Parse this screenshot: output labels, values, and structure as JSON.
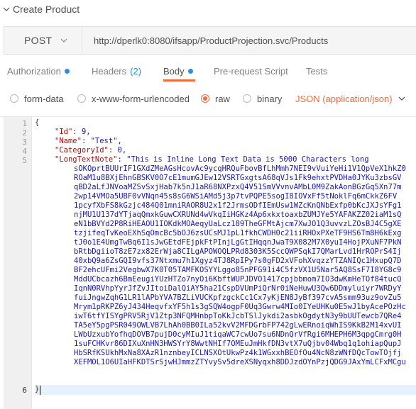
{
  "header": {
    "title": "Create Product"
  },
  "request": {
    "method": "POST",
    "url": "http://dperlk0:8080/ifsapp/ProductProjection.svc/Products"
  },
  "tabs": [
    {
      "label": "Authorization",
      "dot": true
    },
    {
      "label": "Headers",
      "count": "(2)"
    },
    {
      "label": "Body",
      "dot": true
    },
    {
      "label": "Pre-request Script"
    },
    {
      "label": "Tests"
    }
  ],
  "body_options": {
    "form_data": "form-data",
    "urlencoded": "x-www-form-urlencoded",
    "raw": "raw",
    "binary": "binary",
    "format": "JSON (application/json)"
  },
  "editor": {
    "line_numbers": [
      "1",
      "2",
      "3",
      "4",
      "5",
      "6"
    ],
    "open_brace": "{",
    "close_brace": "}",
    "key_id": "\"Id\"",
    "val_id": "9,",
    "key_name": "\"Name\"",
    "val_name": "\"Test\",",
    "key_category": "\"CategoryId\"",
    "val_category": "0,",
    "key_note": "\"LongTextNote\"",
    "note_first": "\"This is Inline Long Text Data is 5000 Characters long",
    "note_lines": [
      "sOKOprtBUUrIF1GXdZMeAGsHcovAc9ycqHRQuFbovBfLhMmh7NEI9vVuiYeHi1V1QpVeX1hkZ0",
      "ROaM1u8BXjEhnGBSKV0O7cE1mumGJEw12VSRTGxgtsA68qVJs1Fk9ehxtPVDHa0JYKu3zbsGV",
      "qBD2aLfJNVoaMZSvSxjHab7k5nJ1aR68NXPzxQ4V51SmVVvnvAMbL0M9ZakAonBGzGq5Xn77m",
      "2wp14VMOa5UBF0vVNqn45s8sG6WSiAMd5j3p7tvPQPE5sogI8IOVxFf5tNoklFq6mCkkZ6FV",
      "1pcyfXbFS8kGzjc484Q01mniRAOR8U2x1f2JrmsODfIEmUsw1WZcKnQNbExfp0bKcJXJsYFg1",
      "njMU1U137dYTjaqQmxkGuwCXRUNd4wVkqIiHGKz4Ap6xkxtoaxbZUMJYe5YAFAKZZ02iaM1sQ",
      "eN1bBVYd2P8RiHEAOU1IOKdkMOAeqyUaLcz189TheGFMtAjcm7XwJO1Q3uvvzLZOsBJ4C5gXE",
      "tzjifeqTvKeoEXhSqOmcBc5bOJ6zsUCsMJ1pL1fkhCWDH0c21iiRHOxPXeTF9HS6Tm8H6kExg",
      "tJ0o1E4UmgTwBq6I1sJwGEtdFEjpkFtPInjLgGtIHqqnJwaT9X082M7X0yuI4HojPXuNF7PkN",
      "bRtbDgiioT8zE7zx82ErWja8CILgAPOWOQLPRd8303K5SccQWPSqkI7QMarLvd1HrROPrS4Ij",
      "40xbQ9a6ZsGQI9vfs37Ntxmu7h1Xgyz4TJ8RpIPy7s0gFD2xVFohXvqzzYTZANIQc1HxupQ7D",
      "BF2ehcUFmi2VegbwX7K0T05TAMFKOSYYLggo85nPFG91i4C5fzVX1U5Nar5AQ8SsF7I8YG8c9",
      "MddUCbcazh6BmEeugiYUzHTZo7nyOi6KbftWUPJDVO1417cpjbbmom7IO3dwKmHeTOf84tucQ",
      "IqnN0RVhpYyrJfZvJItoiDalQiAY5ha21CspDVUmPiQrNr0iNeHuwU3Qw6DDmyluiyr7WRDyY",
      "fuiJngwZqhG1LR1lAPbYVA7BZLiVUCKpfzgckCc1Cx7yKjEN8JyBf397cvA5smm93uz9ovZu5",
      "Mrym1pRKPZ6yJ434HeqvfxYF5h1s3gSQW4ogpF0Uq3Gwrw4MIo0IYeUHKu0E5wJ1byAcePOzHc",
      "iwT6tfYISYgPRV5RjV1Ztp3NFQMHnbpToKkJcbTSlJykdi2asbkOgdytN3y9bUUTewcb7QRe4",
      "TA5eY5pgPSR049OWLVB7LhAh0BB0ILa52kvV2MFDGrbFP742gLwERnoiqWhIS9KkB2M14xvUI",
      "LWbUzxubYofhqDOVB7pujD0cyMIuJ1tiqaWC7cwUo7su6NDnQrVfRgi6MHEPH6M3qpgCmrg0H",
      "1suFCHKvr86DIXuXnHN3HWSYrY8WwtNHIf7OMEuJmHkfDN3vtX7uQjbv04Wbq1q1ohiapQupJ",
      "HbSRfKSUkhMxNa8XAzR1nznbeyICLNSXOtUkwPz4k1WGxxhBEOfOu4NcN8zWNfDQcTowTOjfj",
      "XEFMOL1O6UIaHFKDTSrSjwHJmmzZTYvySv5dreXSNyqxh8DDJzdOYnPzjQDG9JAxYmLCFxMCgu"
    ]
  },
  "colors": {
    "accent": "#f26b3a",
    "tab_dot": "#2a8fd8",
    "json_key": "#aa1111",
    "json_value": "#1a1aa6"
  }
}
